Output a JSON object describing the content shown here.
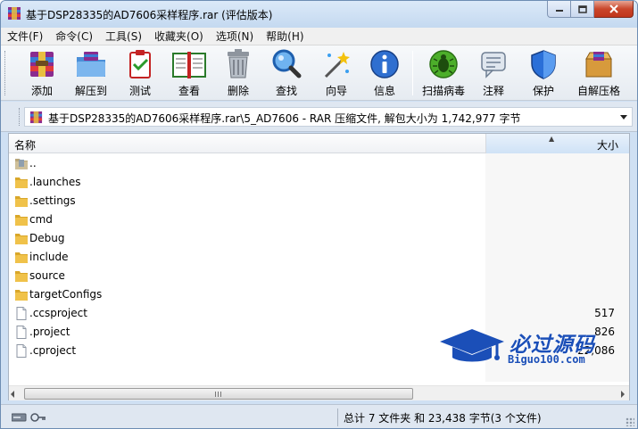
{
  "window": {
    "title": "基于DSP28335的AD7606采样程序.rar (评估版本)"
  },
  "menu": [
    "文件(F)",
    "命令(C)",
    "工具(S)",
    "收藏夹(O)",
    "选项(N)",
    "帮助(H)"
  ],
  "toolbar": {
    "add": "添加",
    "extract_to": "解压到",
    "test": "测试",
    "view": "查看",
    "delete": "删除",
    "find": "查找",
    "wizard": "向导",
    "info": "信息",
    "virus_scan": "扫描病毒",
    "comment": "注释",
    "protect": "保护",
    "sfx": "自解压格"
  },
  "address": {
    "path": "基于DSP28335的AD7606采样程序.rar\\5_AD7606 - RAR 压缩文件, 解包大小为 1,742,977 字节"
  },
  "list": {
    "col_name": "名称",
    "col_size": "大小",
    "rows": [
      {
        "name": "..",
        "size": "",
        "icon": "parent-folder-icon"
      },
      {
        "name": ".launches",
        "size": "",
        "icon": "folder-icon"
      },
      {
        "name": ".settings",
        "size": "",
        "icon": "folder-icon"
      },
      {
        "name": "cmd",
        "size": "",
        "icon": "folder-icon"
      },
      {
        "name": "Debug",
        "size": "",
        "icon": "folder-icon"
      },
      {
        "name": "include",
        "size": "",
        "icon": "folder-icon"
      },
      {
        "name": "source",
        "size": "",
        "icon": "folder-icon"
      },
      {
        "name": "targetConfigs",
        "size": "",
        "icon": "folder-icon"
      },
      {
        "name": ".ccsproject",
        "size": "517",
        "icon": "file-icon"
      },
      {
        "name": ".project",
        "size": "826",
        "icon": "file-icon"
      },
      {
        "name": ".cproject",
        "size": "22,086",
        "icon": "file-icon"
      }
    ]
  },
  "status": {
    "summary": "总计 7 文件夹 和 23,438 字节(3 个文件)"
  },
  "watermark": {
    "brand": "必过源码",
    "url": "Biguo100.com"
  },
  "colors": {
    "title_bg": "#cfe0f3",
    "close_button": "#c9462b",
    "folder": "#e8b93c",
    "watermark_blue": "#1b4fb8"
  }
}
